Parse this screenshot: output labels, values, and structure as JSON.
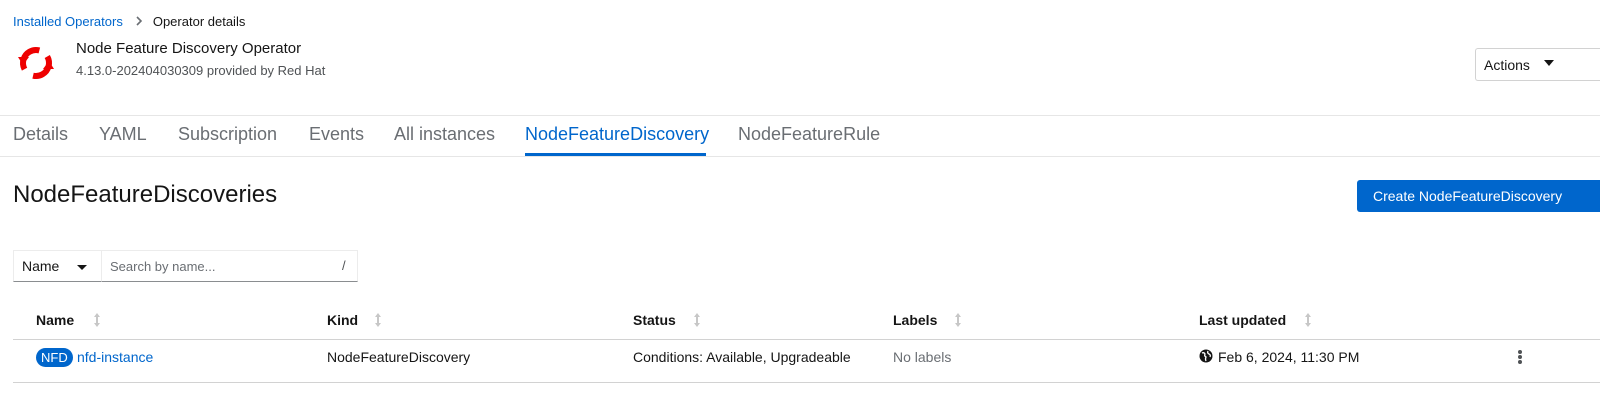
{
  "breadcrumb": {
    "parent": "Installed Operators",
    "separator": ">",
    "current": "Operator details"
  },
  "operator": {
    "logo_icon": "openshift-operator-logo-icon",
    "logo_color": "#ee0000",
    "name": "Node Feature Discovery Operator",
    "subtitle": "4.13.0-202404030309 provided by Red Hat"
  },
  "actions": {
    "label": "Actions"
  },
  "tabs": [
    {
      "label": "Details",
      "active": false
    },
    {
      "label": "YAML",
      "active": false
    },
    {
      "label": "Subscription",
      "active": false
    },
    {
      "label": "Events",
      "active": false
    },
    {
      "label": "All instances",
      "active": false
    },
    {
      "label": "NodeFeatureDiscovery",
      "active": true
    },
    {
      "label": "NodeFeatureRule",
      "active": false
    }
  ],
  "main": {
    "title": "NodeFeatureDiscoveries",
    "create_label": "Create NodeFeatureDiscovery"
  },
  "filter": {
    "type_label": "Name",
    "search_value": "",
    "search_placeholder": "Search by name...",
    "shortcut_hint": "/"
  },
  "table": {
    "columns": [
      "Name",
      "Kind",
      "Status",
      "Labels",
      "Last updated"
    ],
    "rows": [
      {
        "badge": "NFD",
        "name": "nfd-instance",
        "kind": "NodeFeatureDiscovery",
        "status": "Conditions: Available, Upgradeable",
        "labels": "No labels",
        "last_updated": "Feb 6, 2024, 11:30 PM",
        "last_updated_icon": "globe-icon"
      }
    ]
  },
  "colors": {
    "accent": "#0066cc",
    "text": "#151515",
    "muted": "#6a6e73"
  }
}
